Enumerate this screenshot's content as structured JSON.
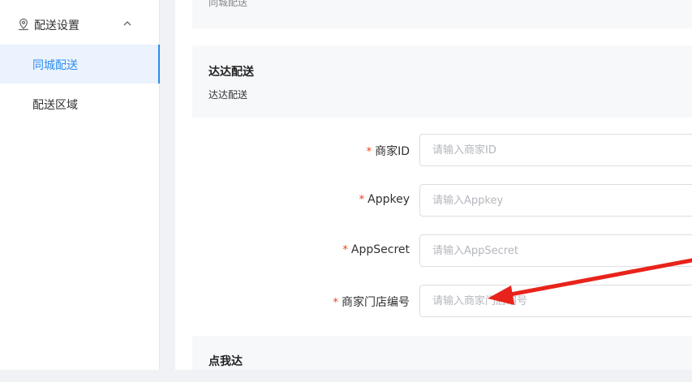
{
  "sidebar": {
    "group": {
      "label": "配送设置",
      "icon": "map-pin-icon"
    },
    "items": [
      {
        "label": "同城配送",
        "active": true
      },
      {
        "label": "配送区域",
        "active": false
      }
    ]
  },
  "sections": {
    "top_cut_sub": "同城配送",
    "dada": {
      "title": "达达配送",
      "subtitle": "达达配送"
    },
    "dianwoda": {
      "title": "点我达"
    }
  },
  "form": {
    "fields": [
      {
        "label": "商家ID",
        "placeholder": "请输入商家ID"
      },
      {
        "label": "Appkey",
        "placeholder": "请输入Appkey"
      },
      {
        "label": "AppSecret",
        "placeholder": "请输入AppSecret"
      },
      {
        "label": "商家门店编号",
        "placeholder": "请输入商家门店编号"
      }
    ],
    "required_mark": "*"
  },
  "colors": {
    "accent": "#2d8cf0",
    "required": "#ed4014",
    "annotation_arrow": "#e8231b"
  }
}
